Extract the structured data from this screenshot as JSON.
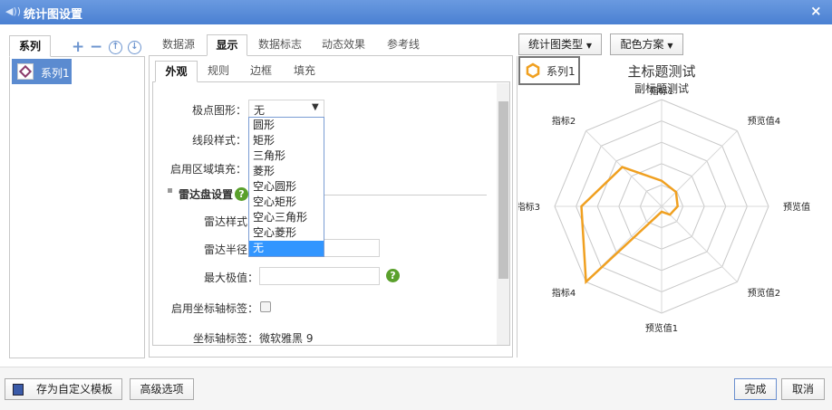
{
  "window": {
    "title": "统计图设置",
    "close": "×"
  },
  "left": {
    "tab": "系列",
    "items": [
      {
        "label": "系列1",
        "selected": true
      }
    ]
  },
  "main_tabs": [
    {
      "label": "数据源"
    },
    {
      "label": "显示",
      "active": true
    },
    {
      "label": "数据标志"
    },
    {
      "label": "动态效果"
    },
    {
      "label": "参考线"
    }
  ],
  "sub_tabs": [
    {
      "label": "外观",
      "active": true
    },
    {
      "label": "规则"
    },
    {
      "label": "边框"
    },
    {
      "label": "填充"
    }
  ],
  "form": {
    "marker_label": "极点图形：",
    "marker_value": "无",
    "marker_options": [
      "圆形",
      "矩形",
      "三角形",
      "菱形",
      "空心圆形",
      "空心矩形",
      "空心三角形",
      "空心菱形",
      "无"
    ],
    "line_style_label": "线段样式：",
    "area_fill_label": "启用区域填充：",
    "radar_section": "雷达盘设置",
    "radar_style_label": "雷达样式：",
    "radar_radius_label": "雷达半径：",
    "max_value_label": "最大极值：",
    "axis_label_enable_label": "启用坐标轴标签：",
    "axis_label_font_label": "坐标轴标签：",
    "axis_label_font_value": "微软雅黑 9"
  },
  "toolbar": {
    "chart_type": "统计图类型",
    "color_scheme": "配色方案"
  },
  "footer": {
    "save_template": "存为自定义模板",
    "advanced": "高级选项",
    "done": "完成",
    "cancel": "取消"
  },
  "colors": {
    "series": "#f0a020",
    "accent": "#4a80d2",
    "selected": "#3296ff"
  },
  "chart_data": {
    "type": "radar",
    "title": "主标题测试",
    "subtitle": "副标题测试",
    "legend": [
      "系列1"
    ],
    "legend_position": "top-left",
    "axes": [
      "指标1",
      "预览值4",
      "预览值",
      "预览值2",
      "预览值1",
      "指标4",
      "指标3",
      "指标2"
    ],
    "series": [
      {
        "name": "系列1",
        "values": [
          24,
          19,
          15,
          11,
          5,
          100,
          75,
          52
        ]
      }
    ],
    "max": 100,
    "rings": 5
  }
}
